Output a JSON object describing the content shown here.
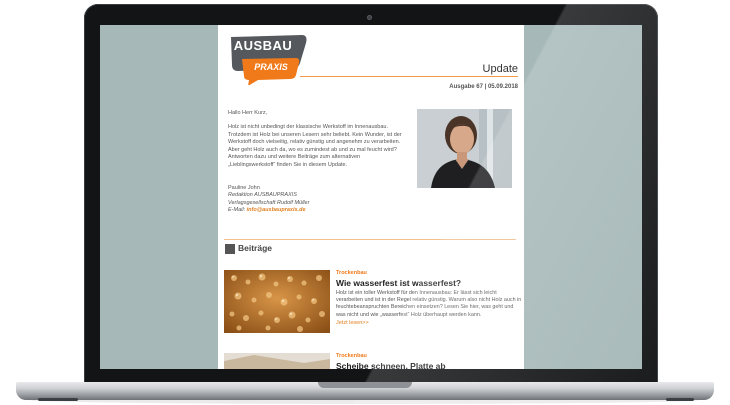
{
  "newsletter": {
    "logo": {
      "line1": "AUSBAU",
      "line2": "PRAXIS"
    },
    "header_title": "Update",
    "issue": "Ausgabe 67 | 05.09.2018",
    "greeting": "Hallo Herr Kurz,",
    "intro": "Holz ist nicht unbedingt der klassische Werkstoff im Innenausbau. Trotzdem ist Holz bei unseren Lesern sehr beliebt. Kein Wunder, ist der Werkstoff doch vielseitig, relativ günstig und angenehm zu verarbeiten. Aber geht Holz auch da, wo es zumindest ab und zu mal feucht wird? Antworten dazu und weitere Beiträge zum alternativen „Lieblingswerkstoff“ finden Sie in diesem Update.",
    "signature": {
      "name": "Pauline John",
      "role": "Redaktion AUSBAUPRAXIS",
      "publisher": "Verlagsgesellschaft Rudolf Müller",
      "email_label": "E-Mail:",
      "email": "info@ausbaupraxis.de"
    },
    "section_title": "Beiträge",
    "articles": [
      {
        "category": "Trockenbau",
        "title": "Wie wasserfest ist wasserfest?",
        "text": "Holz ist ein toller Werkstoff für den Innenausbau: Er lässt sich leicht verarbeiten und ist in der Regel relativ günstig. Warum also nicht Holz auch in feuchtebeanspruchten Bereichen einsetzen? Lesen Sie hier, was geht und was nicht und wie „wasserfest“ Holz überhaupt werden kann.",
        "more": "Jetzt lesen>>"
      },
      {
        "category": "Trockenbau",
        "title": "Scheibe schneen, Platte ab"
      }
    ]
  },
  "colors": {
    "accent": "#f07a1a",
    "logo_dark": "#55595e",
    "screen_bg": "#a6b8b8"
  }
}
